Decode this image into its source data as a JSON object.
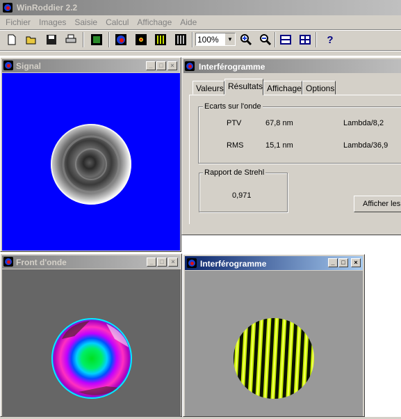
{
  "app": {
    "title": "WinRoddier 2.2"
  },
  "menu": [
    "Fichier",
    "Images",
    "Saisie",
    "Calcul",
    "Affichage",
    "Aide"
  ],
  "toolbar": {
    "zoom_value": "100%",
    "help_label": "?"
  },
  "signal_window": {
    "title": "Signal"
  },
  "front_window": {
    "title": "Front d'onde"
  },
  "results_window": {
    "title": "Interférogramme",
    "tabs": [
      "Valeurs",
      "Résultats",
      "Affichage",
      "Options"
    ],
    "active_tab": "Résultats",
    "ecarts": {
      "label": "Ecarts sur l'onde",
      "rows": [
        {
          "name": "PTV",
          "value": "67,8 nm",
          "lambda": "Lambda/8,2"
        },
        {
          "name": "RMS",
          "value": "15,1 nm",
          "lambda": "Lambda/36,9"
        }
      ]
    },
    "strehl": {
      "label": "Rapport de Strehl",
      "value": "0,971"
    },
    "afficher_button": "Afficher les"
  },
  "interfero_window": {
    "title": "Interférogramme"
  },
  "colors": {
    "signal_bg": "#0000ff",
    "front_bg": "#666666",
    "interfero_bg": "#999999",
    "title_active": "#0a246a",
    "title_inactive": "#808080"
  }
}
